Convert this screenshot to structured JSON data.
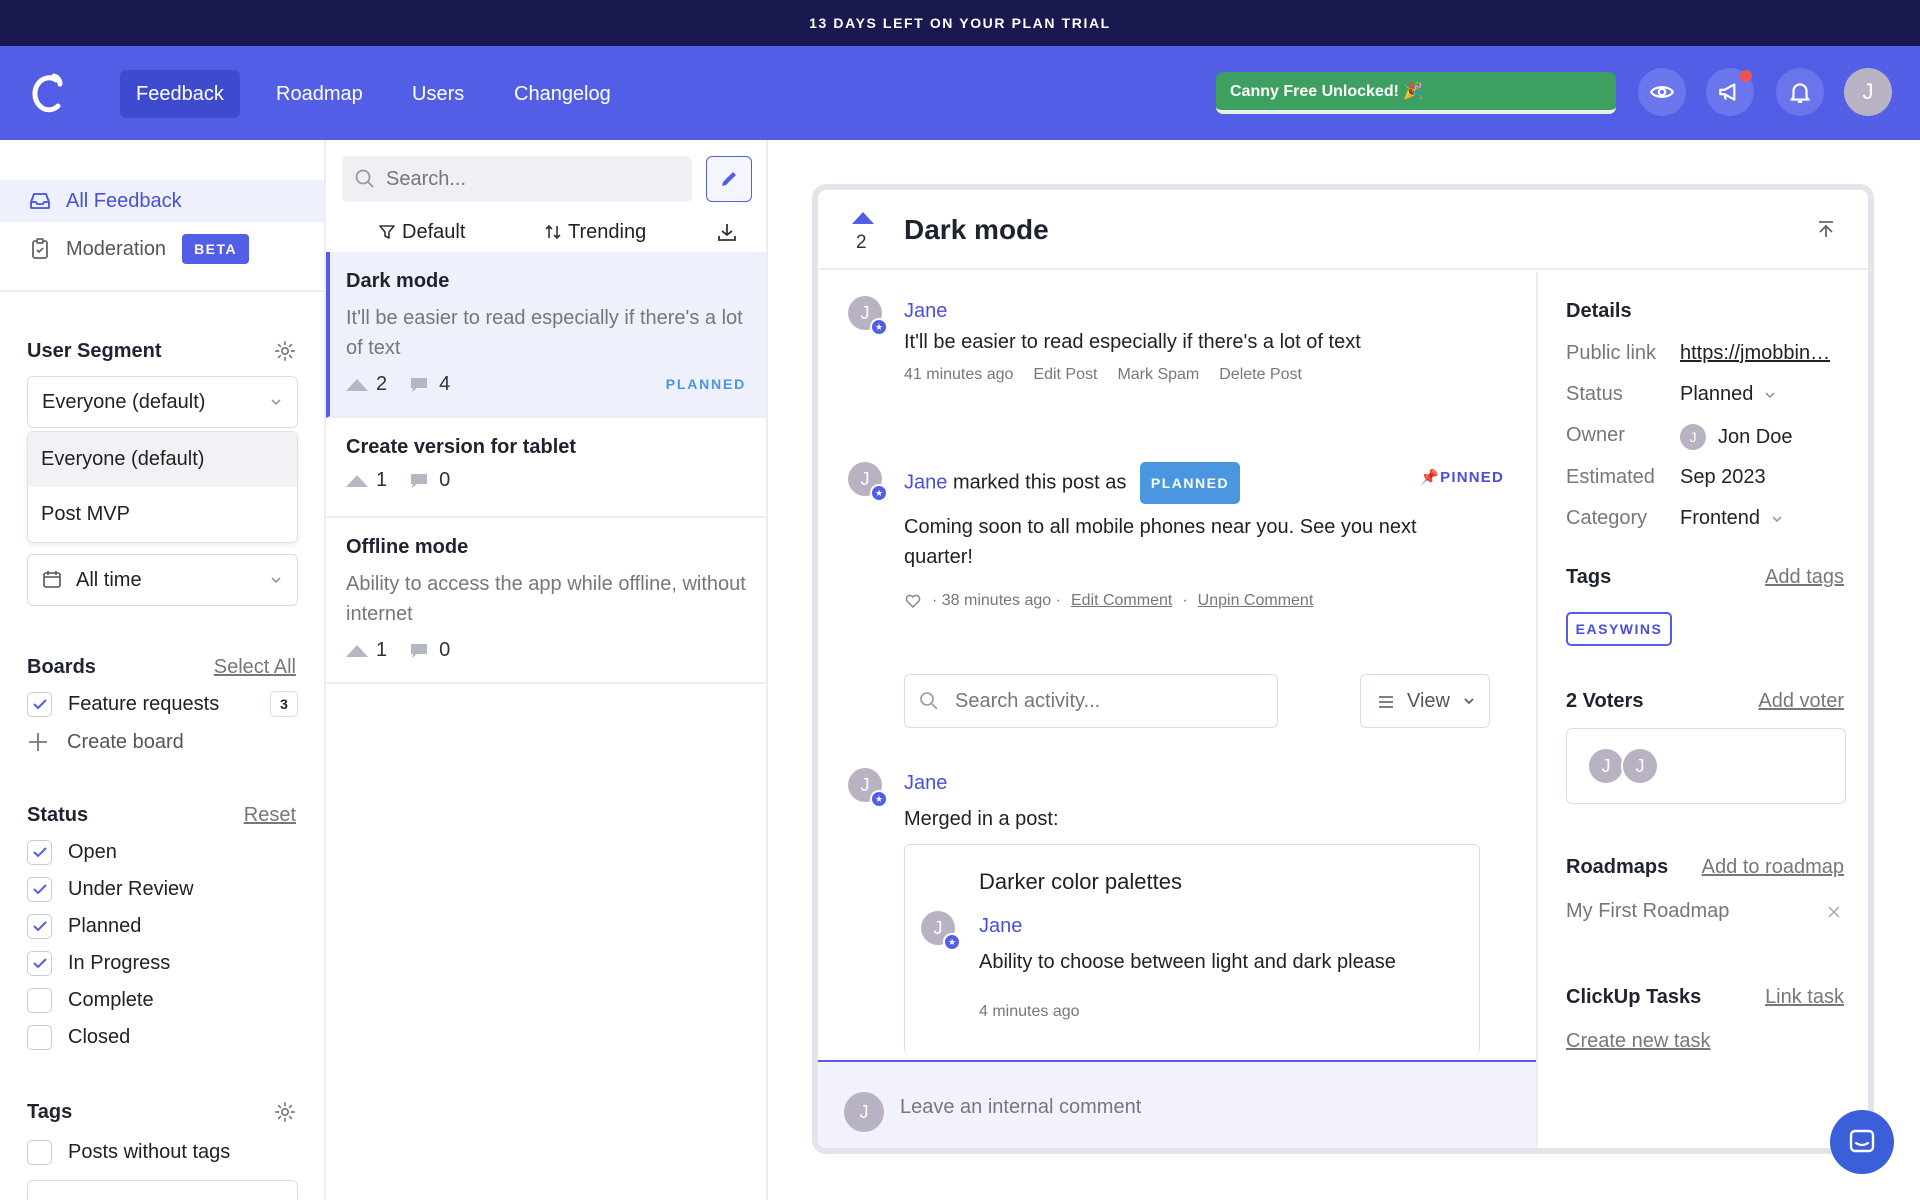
{
  "banner": {
    "text": "13 DAYS LEFT ON YOUR PLAN TRIAL"
  },
  "nav": {
    "tabs": [
      {
        "label": "Feedback"
      },
      {
        "label": "Roadmap"
      },
      {
        "label": "Users"
      },
      {
        "label": "Changelog"
      }
    ],
    "unlock_label": "Canny Free Unlocked! 🎉",
    "avatar": "J",
    "brand_color": "#525ee6"
  },
  "sidebar": {
    "items": [
      {
        "label": "All Feedback",
        "icon": "inbox-icon"
      },
      {
        "label": "Moderation",
        "icon": "clipboard-icon",
        "badge": "BETA"
      }
    ],
    "user_segment": {
      "title": "User Segment",
      "selected": "Everyone (default)",
      "options": [
        "Everyone (default)",
        "Post MVP"
      ]
    },
    "date_filter": "All time",
    "boards": {
      "title": "Boards",
      "link": "Select All",
      "items": [
        {
          "label": "Feature requests",
          "count": "3",
          "checked": true
        }
      ],
      "create": "Create board"
    },
    "status": {
      "title": "Status",
      "link": "Reset",
      "items": [
        {
          "label": "Open",
          "checked": true
        },
        {
          "label": "Under Review",
          "checked": true
        },
        {
          "label": "Planned",
          "checked": true
        },
        {
          "label": "In Progress",
          "checked": true
        },
        {
          "label": "Complete",
          "checked": false
        },
        {
          "label": "Closed",
          "checked": false
        }
      ]
    },
    "tags": {
      "title": "Tags",
      "items": [
        {
          "label": "Posts without tags",
          "checked": false
        }
      ]
    }
  },
  "postlist": {
    "search_placeholder": "Search...",
    "filter_label": "Default",
    "sort_label": "Trending",
    "posts": [
      {
        "title": "Dark mode",
        "desc": "It'll be easier to read especially if there's a lot of text",
        "votes": "2",
        "comments": "4",
        "status": "PLANNED"
      },
      {
        "title": "Create version for tablet",
        "desc": "",
        "votes": "1",
        "comments": "0",
        "status": ""
      },
      {
        "title": "Offline mode",
        "desc": "Ability to access the app while offline, without internet",
        "votes": "1",
        "comments": "0",
        "status": ""
      }
    ]
  },
  "detail": {
    "votes": "2",
    "title": "Dark mode",
    "post": {
      "author": "Jane",
      "avatar": "J",
      "body": "It'll be easier to read especially if there's a lot of text",
      "time": "41 minutes ago",
      "actions": [
        "Edit Post",
        "Mark Spam",
        "Delete Post"
      ]
    },
    "status_update": {
      "author": "Jane",
      "avatar": "J",
      "prefix": "marked this post as",
      "status": "PLANNED",
      "pinned": "PINNED",
      "body": "Coming soon to all mobile phones near you. See you next quarter!",
      "time": "· 38 minutes ago ·",
      "actions": [
        "Edit Comment",
        "Unpin Comment"
      ]
    },
    "activity_search_placeholder": "Search activity...",
    "view_label": "View",
    "merge": {
      "author": "Jane",
      "avatar": "J",
      "body": "Merged in a post:",
      "merged_title": "Darker color palettes",
      "merged_author": "Jane",
      "merged_avatar": "J",
      "merged_body": "Ability to choose between light and dark please",
      "merged_time": "4 minutes ago"
    },
    "comment_placeholder": "Leave an internal comment",
    "comment_avatar": "J"
  },
  "details_panel": {
    "title": "Details",
    "rows": [
      {
        "label": "Public link",
        "value": "https://jmobbin…"
      },
      {
        "label": "Status",
        "value": "Planned"
      },
      {
        "label": "Owner",
        "value": "Jon Doe",
        "avatar": "J"
      },
      {
        "label": "Estimated",
        "value": "Sep 2023"
      },
      {
        "label": "Category",
        "value": "Frontend"
      }
    ],
    "tags": {
      "title": "Tags",
      "link": "Add tags",
      "items": [
        "EASYWINS"
      ]
    },
    "voters": {
      "title": "2 Voters",
      "link": "Add voter",
      "avatars": [
        "J",
        "J"
      ]
    },
    "roadmaps": {
      "title": "Roadmaps",
      "link": "Add to roadmap",
      "items": [
        "My First Roadmap"
      ]
    },
    "clickup": {
      "title": "ClickUp Tasks",
      "link": "Link task",
      "create": "Create new task"
    }
  }
}
